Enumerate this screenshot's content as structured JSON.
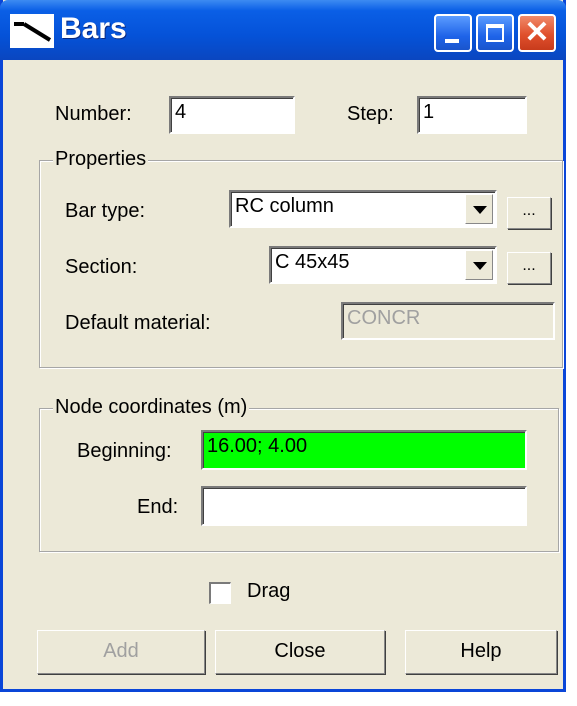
{
  "window": {
    "title": "Bars",
    "icons": {
      "app": "bar-line-icon",
      "minimize": "minimize-icon",
      "maximize": "maximize-icon",
      "close": "close-icon"
    },
    "close_glyph": "✕"
  },
  "numbering": {
    "number_label": "Number:",
    "number_value": "4",
    "step_label": "Step:",
    "step_value": "1"
  },
  "properties": {
    "title": "Properties",
    "bar_type_label": "Bar type:",
    "bar_type_value": "RC column",
    "section_label": "Section:",
    "section_value": "C 45x45",
    "default_material_label": "Default material:",
    "default_material_value": "CONCR",
    "browse_label": "..."
  },
  "node_coordinates": {
    "title": "Node coordinates (m)",
    "beginning_label": "Beginning:",
    "beginning_value": "16.00; 4.00",
    "end_label": "End:",
    "end_value": ""
  },
  "drag": {
    "label": "Drag",
    "checked": false
  },
  "buttons": {
    "add": "Add",
    "close": "Close",
    "help": "Help"
  },
  "colors": {
    "titlebar": "#0552d8",
    "highlight_field": "#00ff00",
    "dialog_bg": "#ece9d8"
  }
}
